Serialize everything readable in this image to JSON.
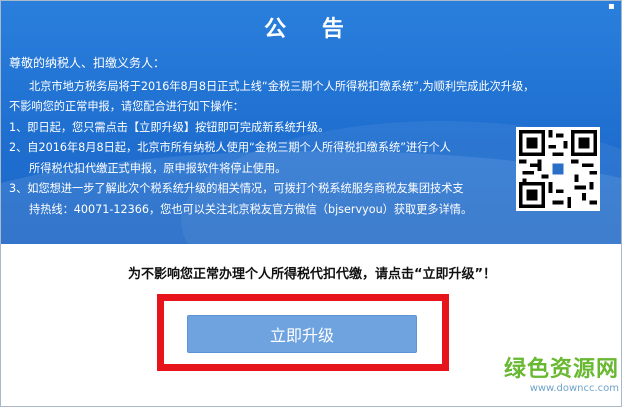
{
  "announcement": {
    "title": "公 告",
    "greeting": "尊敬的纳税人、扣缴义务人：",
    "paragraph_line1": "北京市地方税务局将于2016年8月8日正式上线“金税三期个人所得税扣缴系统”,为顺利完成此次升级，",
    "paragraph_line2": "不影响您的正常申报，请您配合进行如下操作：",
    "item1": "1、即日起，您只需点击【立即升级】按钮即可完成新系统升级。",
    "item2_line1": "2、自2016年8月8日起，北京市所有纳税人使用“金税三期个人所得税扣缴系统”进行个人",
    "item2_line2": "所得税代扣代缴正式申报，原申报软件将停止使用。",
    "item3_line1": "3、如您想进一步了解此次个税系统升级的相关情况，可拨打个税系统服务商税友集团技术支",
    "item3_line2": "持热线：40071-12366，您也可以关注北京税友官方微信（bjservyou）获取更多详情。"
  },
  "notice_text": "为不影响您正常办理个人所得税代扣代缴，请点击“立即升级”！",
  "upgrade_button_label": "立即升级",
  "watermark": {
    "name": "绿色资源网",
    "site": "www.downcc.com"
  },
  "colors": {
    "banner_blue": "#1f6fd0",
    "button_blue": "#6ea3e0",
    "highlight_red": "#e8141c",
    "watermark_green": "#68b832"
  }
}
